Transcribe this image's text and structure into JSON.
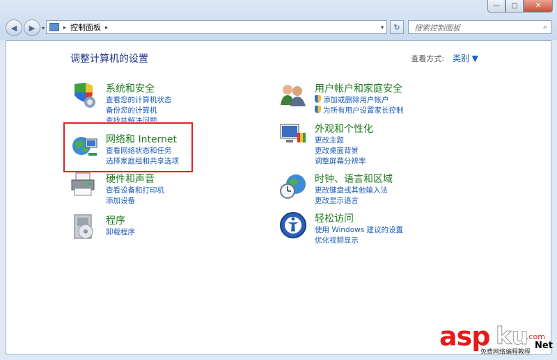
{
  "window": {
    "min": "—",
    "max": "□",
    "close": "✕"
  },
  "nav": {
    "back": "◀",
    "forward": "▶",
    "dropdown": "▾"
  },
  "address": {
    "breadcrumb_sep": "▸",
    "location": "控制面板",
    "after_sep": "▸",
    "dropdown": "▾"
  },
  "refresh_label": "↻",
  "search": {
    "placeholder": "搜索控制面板",
    "icon": "⌕"
  },
  "page": {
    "title": "调整计算机的设置",
    "view_by_label": "查看方式:",
    "view_by_value": "类别 ▼"
  },
  "categories_left": [
    {
      "title": "系统和安全",
      "links": [
        "查看您的计算机状态",
        "备份您的计算机",
        "查找并解决问题"
      ]
    },
    {
      "title": "网络和 Internet",
      "links": [
        "查看网络状态和任务",
        "选择家庭组和共享选项"
      ]
    },
    {
      "title": "硬件和声音",
      "links": [
        "查看设备和打印机",
        "添加设备"
      ]
    },
    {
      "title": "程序",
      "links": [
        "卸载程序"
      ]
    }
  ],
  "categories_right": [
    {
      "title": "用户帐户和家庭安全",
      "links": [
        "添加或删除用户帐户",
        "为所有用户设置家长控制"
      ]
    },
    {
      "title": "外观和个性化",
      "links": [
        "更改主题",
        "更改桌面背景",
        "调整屏幕分辨率"
      ]
    },
    {
      "title": "时钟、语言和区域",
      "links": [
        "更改键盘或其他输入法",
        "更改显示语言"
      ]
    },
    {
      "title": "轻松访问",
      "links": [
        "使用 Windows 建议的设置",
        "优化视频显示"
      ]
    }
  ],
  "watermark": {
    "asp": "asp",
    "ku": "ku",
    "com": ".com",
    "net": "Net",
    "sub": "免费网络编程教程"
  },
  "colors": {
    "category_title": "#1e7a21",
    "link": "#1c5cb5",
    "page_title": "#1e3287",
    "highlight": "#e02222"
  }
}
